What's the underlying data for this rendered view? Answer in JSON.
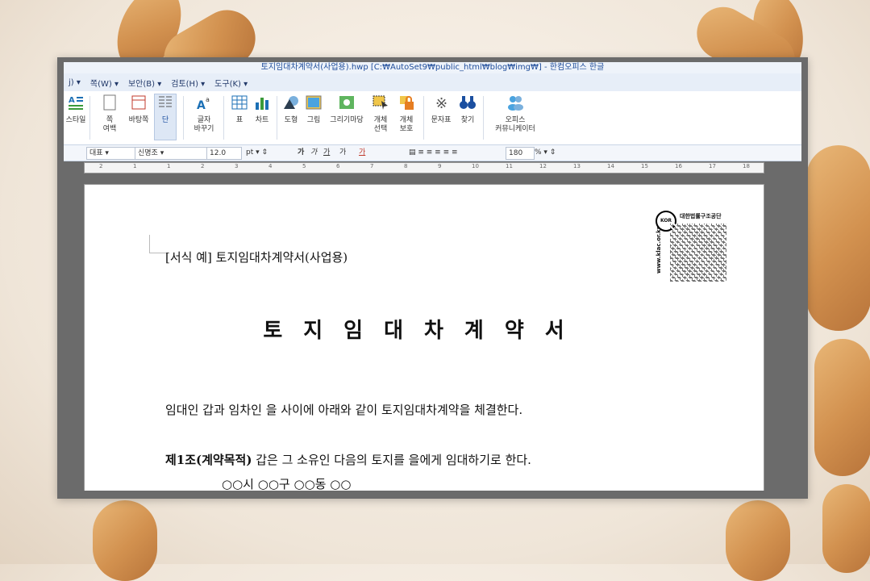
{
  "window": {
    "title": "토지임대차계약서(사업용).hwp [C:₩AutoSet9₩public_html₩blog₩img₩] - 한컴오피스 한글"
  },
  "menu": {
    "items": [
      "j) ▾",
      "쪽(W) ▾",
      "보안(B) ▾",
      "검토(H) ▾",
      "도구(K) ▾"
    ]
  },
  "ribbon": {
    "style": "스타일",
    "page_margin_top": "쪽",
    "page_margin_bottom": "여백",
    "page_border_bg": "바탕쪽",
    "column": "단",
    "char_change_top": "글자",
    "char_change_bottom": "바꾸기",
    "table": "표",
    "chart": "차트",
    "shape": "도형",
    "image": "그림",
    "drawing_gallery": "그리기마당",
    "object_select_top": "개체",
    "object_select_bottom": "선택",
    "object_protect_top": "개체",
    "object_protect_bottom": "보호",
    "char_map": "문자표",
    "find": "찾기",
    "office_comm_top": "오피스",
    "office_comm_bottom": "커뮤니케이터"
  },
  "format_bar": {
    "style_value": "대표",
    "font_value": "신명조",
    "size_value": "12.0",
    "unit_value": "pt",
    "bold": "가",
    "italic": "가",
    "underline": "가",
    "strike": "가",
    "color": "가",
    "line_spacing_value": "180",
    "line_spacing_unit": "%"
  },
  "ruler": {
    "numbers": [
      "2",
      "1",
      "1",
      "2",
      "3",
      "4",
      "5",
      "6",
      "7",
      "8",
      "9",
      "10",
      "11",
      "12",
      "13",
      "14",
      "15",
      "16",
      "17",
      "18"
    ]
  },
  "document": {
    "header_line": "[서식 예] 토지임대차계약서(사업용)",
    "title": "토지임대차계약서",
    "para1": "임대인 갑과 임차인 을 사이에 아래와 같이 토지임대차계약을 체결한다.",
    "para2_bold": "제1조(계약목적)",
    "para2_rest": " 갑은 그 소유인 다음의 토지를 을에게 임대하기로 한다.",
    "para3": "○○시 ○○구 ○○동 ○○",
    "logo_text": "대한법률구조공단",
    "logo_mark": "KOR",
    "logo_url": "www.klac.or.kr"
  }
}
